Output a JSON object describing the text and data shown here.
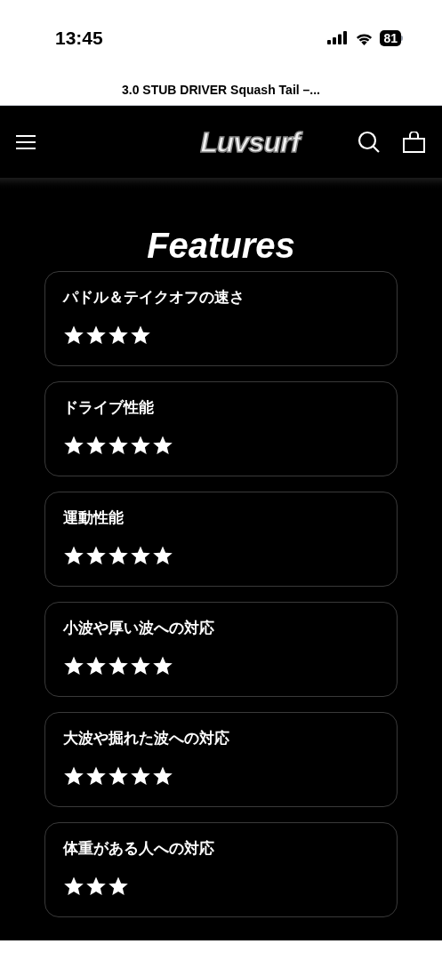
{
  "status_bar": {
    "time": "13:45",
    "battery": "81"
  },
  "page_title": "3.0 STUB DRIVER Squash Tail –...",
  "header": {
    "logo": "Luvsurf"
  },
  "section_title": "Features",
  "features": [
    {
      "label": "パドル＆テイクオフの速さ",
      "stars": 4
    },
    {
      "label": "ドライブ性能",
      "stars": 5
    },
    {
      "label": "運動性能",
      "stars": 5
    },
    {
      "label": "小波や厚い波への対応",
      "stars": 5
    },
    {
      "label": "大波や掘れた波への対応",
      "stars": 5
    },
    {
      "label": "体重がある人への対応",
      "stars": 3
    }
  ]
}
